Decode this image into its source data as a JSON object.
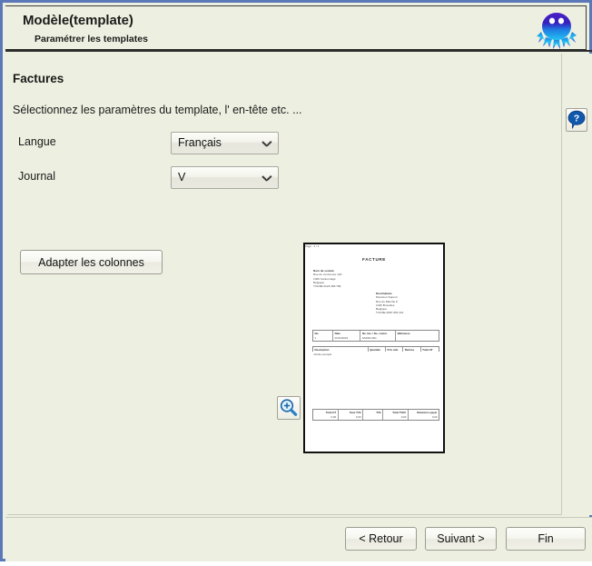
{
  "window": {
    "frame_color": "#5b79b8",
    "background_color": "#edf0e0"
  },
  "header": {
    "title": "Modèle(template)",
    "subtitle": "Paramétrer les templates",
    "logo_icon": "octopus-mascot-icon",
    "logo_colors": [
      "#3a1fb5",
      "#2bb8f0",
      "#1452d0"
    ]
  },
  "help": {
    "icon": "help-question-icon",
    "label": "?",
    "color": "#1057a8"
  },
  "main": {
    "section_title": "Factures",
    "instructions": "Sélectionnez les paramètres du template, l' en-tête etc. ...",
    "fields": [
      {
        "label": "Langue",
        "value": "Français",
        "icon": "chevron-down-icon"
      },
      {
        "label": "Journal",
        "value": "V",
        "icon": "chevron-down-icon"
      }
    ],
    "adapt_button": "Adapter les colonnes",
    "zoom_button_icon": "magnifier-plus-icon"
  },
  "preview": {
    "title": "FACTURE",
    "sender": [
      "Nom de societe",
      "Rue du commerce 120",
      "1000 Cantonnage",
      "Belgique",
      "TVA BE 0123.456.789"
    ],
    "recipient": [
      "Destinataire",
      "Monsieur Dupont",
      "Rue du Marche 8",
      "1040 Bruxelles",
      "Belgique",
      "TVA BE 0987.654.321"
    ],
    "page_label": "Page : 1 / 1",
    "info_headers": [
      "No.",
      "Date",
      "No. fac. / No. comm.",
      "Référence"
    ],
    "info_row": [
      "1",
      "01/01/2024",
      "FA2024-001",
      ""
    ],
    "line_headers": [
      "Description",
      "Quantite",
      "Prix unit.",
      "Remise",
      "Total HT"
    ],
    "line_row": [
      "Article exemple",
      "",
      "",
      "",
      ""
    ],
    "total_headers": [
      "Total HT",
      "Taux TVA",
      "TVA",
      "Total TVAC",
      "Montant a payer"
    ],
    "total_row": [
      "0,00",
      "0,00",
      "",
      "0,00",
      "0,00"
    ]
  },
  "footer": {
    "buttons": [
      {
        "label": "< Retour",
        "name": "back-button"
      },
      {
        "label": "Suivant >",
        "name": "next-button"
      },
      {
        "label": "Fin",
        "name": "finish-button"
      }
    ]
  }
}
